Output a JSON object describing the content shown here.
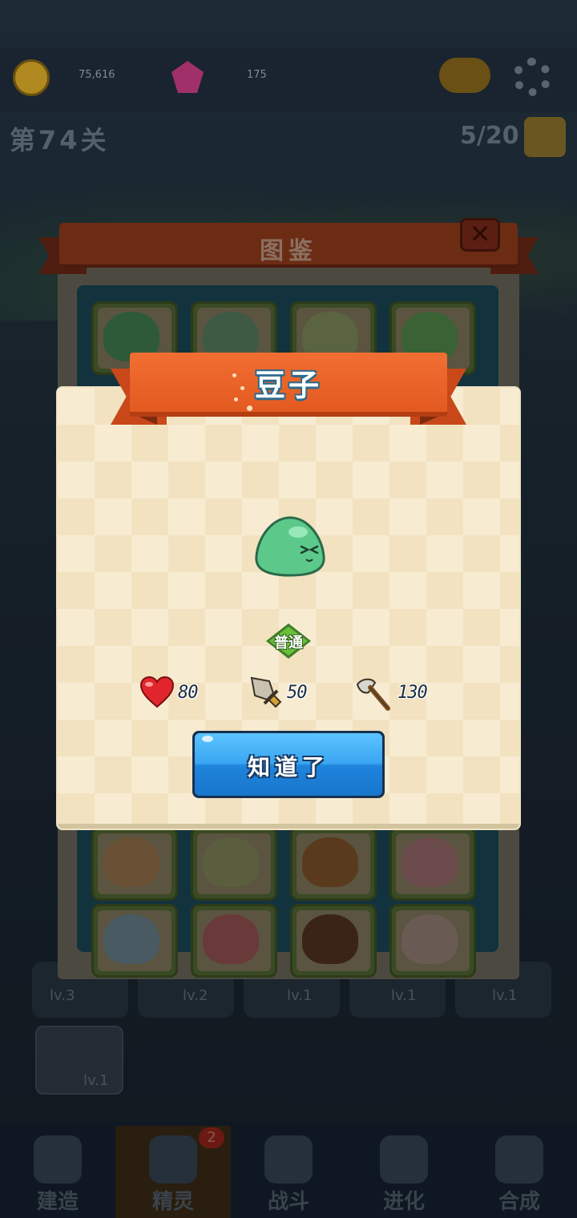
{
  "hud": {
    "coins": "75,616",
    "gems": "175",
    "stage_label": "第74关",
    "wave_label": "5/20"
  },
  "codex": {
    "title": "图鉴",
    "close_glyph": "✕"
  },
  "heroes": [
    {
      "level": "lv.3"
    },
    {
      "level": "lv.2"
    },
    {
      "level": "lv.1"
    },
    {
      "level": "lv.1"
    },
    {
      "level": "lv.1"
    }
  ],
  "tower_card_level": "lv.1",
  "bottom_nav": {
    "tabs": [
      {
        "label": "建造",
        "icon": "hammer-icon"
      },
      {
        "label": "精灵",
        "icon": "spirit-icon",
        "badge": "2",
        "active": true
      },
      {
        "label": "战斗",
        "icon": "swords-icon"
      },
      {
        "label": "进化",
        "icon": "evolve-icon"
      },
      {
        "label": "合成",
        "icon": "merge-icon"
      }
    ]
  },
  "detail": {
    "name": "豆子",
    "rarity": "普通",
    "hp": "80",
    "attack": "50",
    "damage": "130",
    "confirm_label": "知道了",
    "accent_color": "#e35a20",
    "button_color": "#3aa6f2",
    "creature_color": "#5cc98a"
  }
}
